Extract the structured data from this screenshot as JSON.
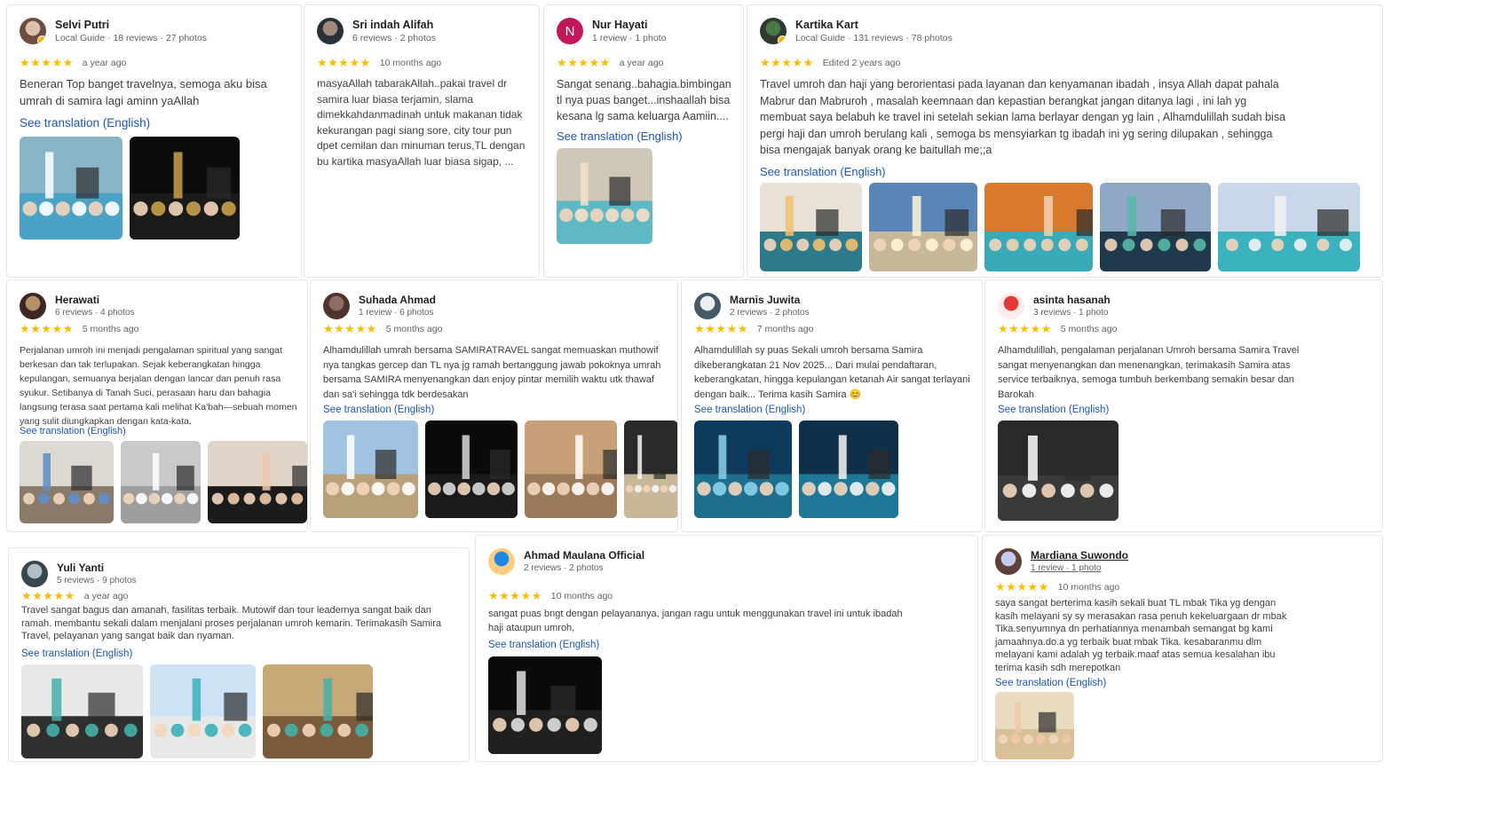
{
  "reviews": [
    {
      "name": "Selvi Putri",
      "meta": "Local Guide · 18 reviews · 27 photos",
      "time": "a year ago",
      "text": "Beneran Top banget travelnya, semoga aku bisa umrah di samira lagi aminn yaAllah",
      "translation": "See translation (English)"
    },
    {
      "name": "Sri indah Alifah",
      "meta": "6 reviews · 2 photos",
      "time": "10 months ago",
      "text": "masyaAllah tabarakAllah..pakai travel dr samira luar biasa terjamin, slama dimekkahdanmadinah untuk makanan tidak kekurangan pagi siang sore, city tour pun dpet cemilan dan minuman terus,TL dengan bu kartika masyaAllah luar biasa sigap, ..."
    },
    {
      "name": "Nur Hayati",
      "initial": "N",
      "meta": "1 review · 1 photo",
      "time": "a year ago",
      "text": "Sangat senang..bahagia.bimbingan tl nya puas banget...inshaallah bisa kesana lg sama keluarga Aamiin....",
      "translation": "See translation (English)"
    },
    {
      "name": "Kartika Kart",
      "meta": "Local Guide · 131 reviews · 78 photos",
      "time": "Edited 2 years ago",
      "text": "Travel umroh dan haji yang berorientasi pada layanan dan kenyamanan ibadah , insya Allah dapat pahala Mabrur dan Mabruroh , masalah keemnaan dan kepastian berangkat jangan ditanya lagi , ini lah yg membuat saya belabuh ke travel ini setelah sekian lama berlayar dengan yg lain , Alhamdulillah sudah bisa pergi haji dan umroh berulang kali , semoga bs mensyiarkan tg ibadah ini yg sering dilupakan , sehingga bisa mengajak banyak orang ke baitullah me;;a",
      "translation": "See translation (English)"
    },
    {
      "name": "Herawati",
      "meta": "6 reviews · 4 photos",
      "time": "5 months ago",
      "text": "Perjalanan umroh ini menjadi pengalaman spiritual yang sangat berkesan dan tak terlupakan. Sejak keberangkatan hingga kepulangan, semuanya berjalan dengan lancar dan penuh rasa syukur. Setibanya di Tanah Suci, perasaan haru dan bahagia langsung terasa saat pertama kali melihat Ka'bah—sebuah momen yang sulit diungkapkan dengan kata-kata.",
      "translation": "See translation (English)"
    },
    {
      "name": "Suhada Ahmad",
      "meta": "1 review · 6 photos",
      "time": "5 months ago",
      "text": "Alhamdulillah umrah bersama SAMIRATRAVEL sangat memuaskan muthowif nya tangkas gercep dan TL nya jg ramah bertanggung jawab pokoknya umrah bersama SAMIRA menyenangkan dan enjoy pintar memilih waktu utk thawaf dan sa'i sehingga tdk berdesakan",
      "translation": "See translation (English)"
    },
    {
      "name": "Marnis Juwita",
      "meta": "2 reviews · 2 photos",
      "time": "7 months ago",
      "text": "Alhamdulillah sy puas Sekali umroh bersama Samira dikeberangkatan 21 Nov 2025... Dari mulai pendaftaran, keberangkatan, hingga kepulangan ketanah Air sangat terlayani dengan baik... Terima kasih Samira 😊",
      "translation": "See translation (English)"
    },
    {
      "name": "asinta hasanah",
      "meta": "3 reviews · 1 photo",
      "time": "5 months ago",
      "text": "Alhamdulillah, pengalaman perjalanan Umroh bersama Samira Travel sangat menyenangkan dan menenangkan, terimakasih Samira atas service terbaiknya, semoga tumbuh berkembang semakin besar dan Barokah",
      "translation": "See translation (English)"
    },
    {
      "name": "Yuli Yanti",
      "meta": "5 reviews · 9 photos",
      "time": "a year ago",
      "text": "Travel sangat bagus dan amanah, fasilitas terbaik. Mutowif dan tour leadernya sangat baik dan ramah. membantu sekali dalam menjalani proses perjalanan umroh kemarin. Terimakasih Samira Travel, pelayanan yang sangat baik dan nyaman.",
      "translation": "See translation (English)"
    },
    {
      "name": "Ahmad Maulana Official",
      "meta": "2 reviews · 2 photos",
      "time": "10 months ago",
      "text": "sangat puas bngt dengan pelayananya, jangan ragu untuk menggunakan travel ini untuk ibadah haji ataupun umroh,",
      "translation": "See translation (English)"
    },
    {
      "name": "Mardiana Suwondo",
      "meta": "1 review · 1 photo",
      "time": "10 months ago",
      "text": "saya sangat berterima kasih sekali buat TL mbak Tika yg dengan kasih melayani sy sy merasakan rasa penuh kekeluargaan dr mbak Tika.senyumnya dn perhatiannya menambah semangat bg kami jamaahnya.do.a yg terbaik buat mbak Tika. kesabaranmu dlm melayani kami adalah yg terbaik.maaf atas semua kesalahan ibu terima kasih sdh merepotkan",
      "translation": "See translation (English)"
    }
  ],
  "stars": "★★★★★",
  "colors": {
    "accent": "#1a55c0",
    "star": "#fbbc04",
    "avatar_initial_bg": "#c2185b"
  }
}
